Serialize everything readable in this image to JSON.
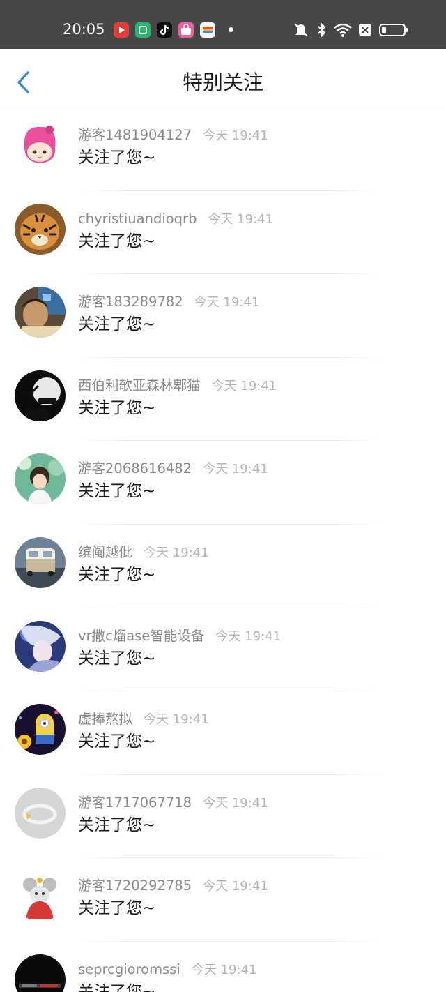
{
  "status_bar": {
    "time": "20:05",
    "apps": [
      {
        "icon": "video-app-icon",
        "color": "#e33a3a"
      },
      {
        "icon": "green-app-icon",
        "color": "#20b86a"
      },
      {
        "icon": "tiktok-app-icon",
        "color": "#111111"
      },
      {
        "icon": "shop-app-icon",
        "color": "#ef5d9c"
      },
      {
        "icon": "wallet-app-icon",
        "color": "#f6f6f6"
      }
    ],
    "system_icons": [
      "mute-vibrate-icon",
      "bluetooth-icon",
      "wifi-icon",
      "no-sim-icon",
      "battery-icon"
    ],
    "battery_level": 0.15
  },
  "nav": {
    "back_icon": "chevron-left-icon",
    "title": "特别关注",
    "accent": "#2f8bd8"
  },
  "items": [
    {
      "name": "游客1481904127",
      "time": "今天 19:41",
      "message": "关注了您~",
      "avatar": "anime-girl-avatar"
    },
    {
      "name": "chyristiuandioqrb",
      "time": "今天 19:41",
      "message": "关注了您~",
      "avatar": "tiger-avatar"
    },
    {
      "name": "游客183289782",
      "time": "今天 19:41",
      "message": "关注了您~",
      "avatar": "boy-photo-avatar"
    },
    {
      "name": "西伯利欹亚森林郫猫",
      "time": "今天 19:41",
      "message": "关注了您~",
      "avatar": "halloween-avatar"
    },
    {
      "name": "游客2068616482",
      "time": "今天 19:41",
      "message": "关注了您~",
      "avatar": "girl-photo-avatar"
    },
    {
      "name": "缤阄越仳",
      "time": "今天 19:41",
      "message": "关注了您~",
      "avatar": "vw-bus-avatar"
    },
    {
      "name": "vr撒c熘ase智能设备",
      "time": "今天 19:41",
      "message": "关注了您~",
      "avatar": "anime-art-avatar"
    },
    {
      "name": "虚捧熬拟",
      "time": "今天 19:41",
      "message": "关注了您~",
      "avatar": "minion-avatar"
    },
    {
      "name": "游客1717067718",
      "time": "今天 19:41",
      "message": "关注了您~",
      "avatar": "ring-avatar"
    },
    {
      "name": "游客1720292785",
      "time": "今天 19:41",
      "message": "关注了您~",
      "avatar": "cartoon-mouse-avatar"
    },
    {
      "name": "seprcgioromssi",
      "time": "今天 19:41",
      "message": "关注了您~",
      "avatar": "dark-text-avatar"
    }
  ]
}
